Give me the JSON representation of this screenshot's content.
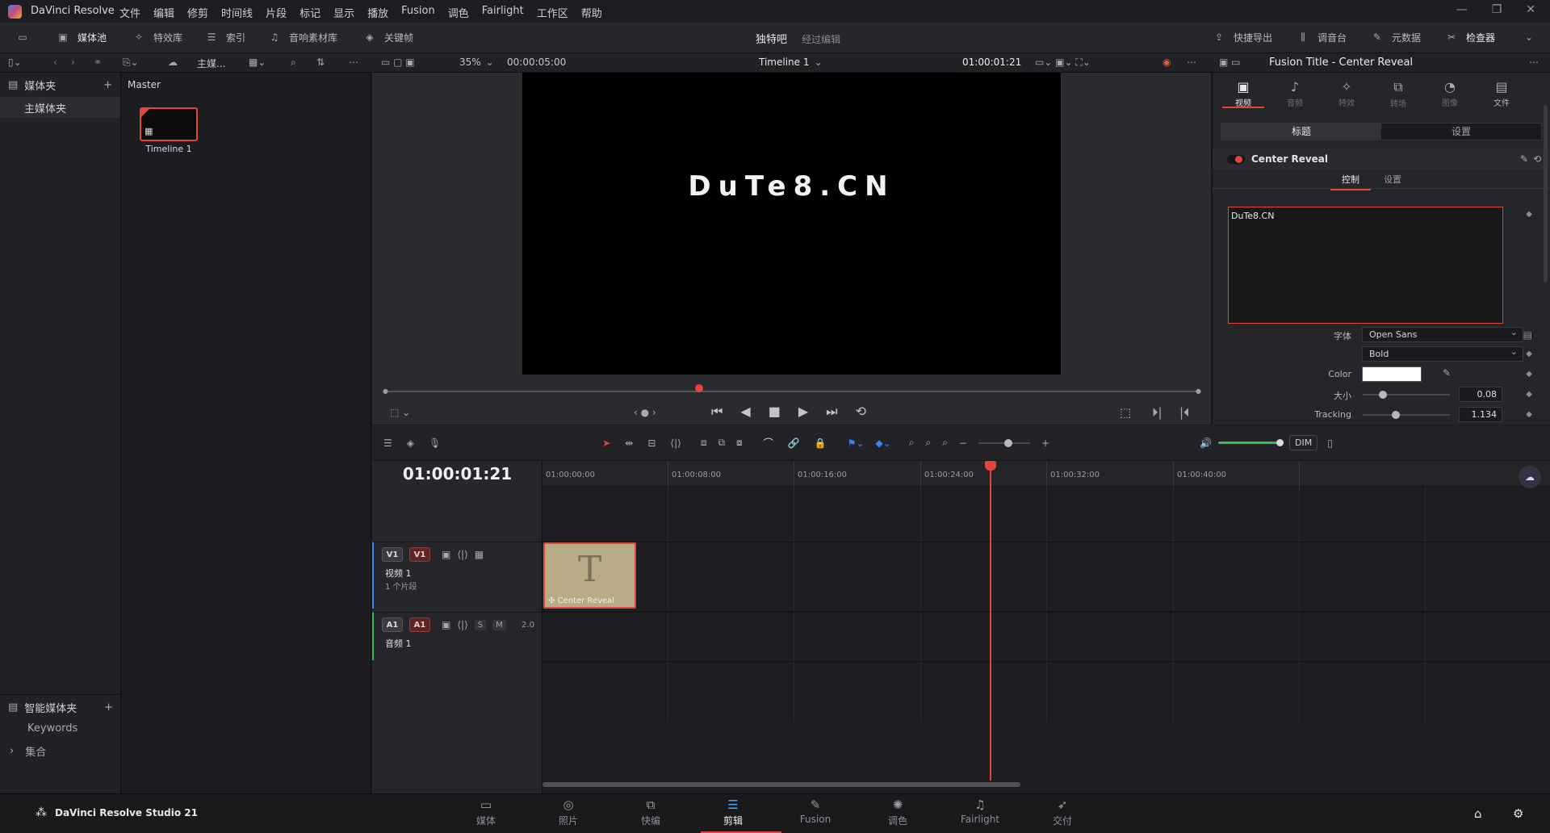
{
  "app": {
    "name": "DaVinci Resolve"
  },
  "menu": [
    "文件",
    "编辑",
    "修剪",
    "时间线",
    "片段",
    "标记",
    "显示",
    "播放",
    "Fusion",
    "调色",
    "Fairlight",
    "工作区",
    "帮助"
  ],
  "toolbar": {
    "media_pool": "媒体池",
    "effects": "特效库",
    "index": "索引",
    "sound_library": "音响素材库",
    "keyframes": "关键帧",
    "project_name": "独特吧",
    "project_status": "经过编辑",
    "quick_export": "快捷导出",
    "mixer": "调音台",
    "metadata": "元数据",
    "inspector": "检查器"
  },
  "bar2": {
    "bin_path": "主媒...",
    "zoom": "35%",
    "duration": "00:00:05:00",
    "timeline_name": "Timeline 1",
    "timecode": "01:00:01:21",
    "inspector_title": "Fusion Title - Center Reveal"
  },
  "left_panel": {
    "header": "媒体夹",
    "master_bin": "主媒体夹",
    "smart_bins": "智能媒体夹",
    "keywords": "Keywords",
    "collections": "集合"
  },
  "media_pool": {
    "title": "Master",
    "clips": [
      {
        "name": "Timeline 1"
      }
    ]
  },
  "viewer": {
    "title_text": "DuTe8.CN"
  },
  "inspector": {
    "tabs": [
      "视频",
      "音频",
      "特效",
      "转场",
      "图像",
      "文件"
    ],
    "subtabs": [
      "标题",
      "设置"
    ],
    "effect_name": "Center Reveal",
    "controls_tabs": [
      "控制",
      "设置"
    ],
    "text_value": "DuTe8.CN",
    "font_label": "字体",
    "font_value": "Open Sans",
    "style_value": "Bold",
    "color_label": "Color",
    "size_label": "大小",
    "size_value": "0.08",
    "tracking_label": "Tracking",
    "tracking_value": "1.134"
  },
  "timeline": {
    "timecode": "01:00:01:21",
    "ruler_ticks": [
      "01:00:00:00",
      "01:00:08:00",
      "01:00:16:00",
      "01:00:24:00",
      "01:00:32:00",
      "01:00:40:00"
    ],
    "video_track": {
      "tag": "V1",
      "tag2": "V1",
      "name": "视频 1",
      "clip_count": "1 个片段"
    },
    "audio_track": {
      "tag": "A1",
      "tag2": "A1",
      "name": "音频 1",
      "level": "2.0",
      "solo": "S",
      "mute": "M"
    },
    "clip_name": "Center Reveal",
    "dim_label": "DIM"
  },
  "bottom": {
    "brand": "DaVinci Resolve Studio 21",
    "nav": [
      "媒体",
      "照片",
      "快编",
      "剪辑",
      "Fusion",
      "调色",
      "Fairlight",
      "交付"
    ]
  }
}
